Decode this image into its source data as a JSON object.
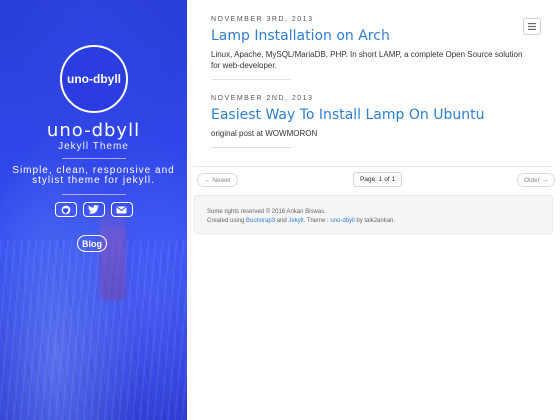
{
  "sidebar": {
    "logo_text": "uno-dbyll",
    "title": "uno-dbyll",
    "subtitle": "Jekyll Theme",
    "tagline": "Simple, clean, responsive and stylist theme for jekyll.",
    "social": [
      {
        "icon": "github-icon"
      },
      {
        "icon": "twitter-icon"
      },
      {
        "icon": "mail-icon"
      }
    ],
    "blog_label": "Blog"
  },
  "posts": [
    {
      "date": "November 3rd, 2013",
      "title": "Lamp Installation on Arch",
      "excerpt": "Linux, Apache, MySQL/MariaDB, PHP. In short LAMP, a complete Open Source solution for web-developer."
    },
    {
      "date": "November 2nd, 2013",
      "title": "Easiest Way To Install Lamp On Ubuntu",
      "excerpt": "original post at WOWMORON"
    }
  ],
  "pager": {
    "newer": "← Newer",
    "page": "Page: 1 of 1",
    "older": "Older →"
  },
  "footer": {
    "line1": "Some rights reserved © 2016 Ankan Biswas.",
    "line2_prefix": "Created using ",
    "bootstrap": "Bootstrap3",
    "and": " and ",
    "jekyll": "Jekyll",
    "theme_prefix": ". Theme : ",
    "theme": "uno-dbyll",
    "by": " by talk2ankan."
  },
  "colors": {
    "accent": "#2f7fcf",
    "sidebar_blue": "#2f45e8"
  }
}
